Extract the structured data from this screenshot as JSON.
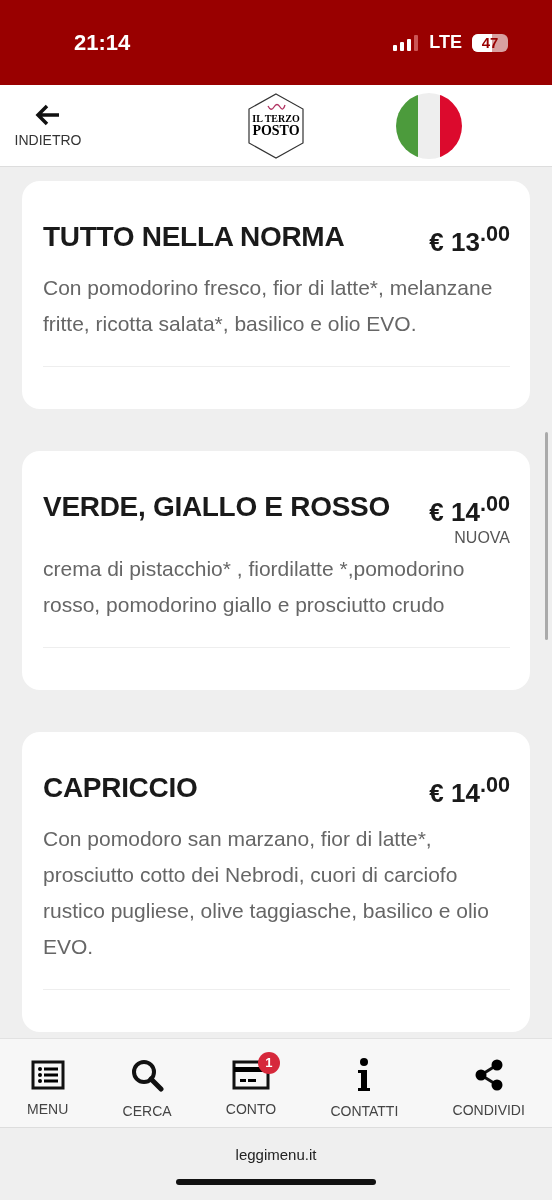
{
  "status_bar": {
    "time": "21:14",
    "network": "LTE",
    "battery": "47"
  },
  "header": {
    "back_label": "INDIETRO",
    "logo": {
      "line1": "IL TERZO",
      "line2": "POSTO"
    }
  },
  "dishes": [
    {
      "name": "TUTTO NELLA NORMA",
      "price": "€ 13$^{.00}$",
      "description": "Con pomodorino fresco, fior di latte*, melanzane fritte, ricotta salata*, basilico e olio EVO."
    },
    {
      "name": "VERDE, GIALLO E ROSSO",
      "price": "€ 14$^{.00}$",
      "badge": "NUOVA",
      "description": "crema di pistacchio* , fiordilatte *,pomodorino rosso, pomodorino giallo e prosciutto crudo"
    },
    {
      "name": "CAPRICCIO",
      "price": "€ 14$^{.00}$",
      "description": "Con pomodoro san marzano, fior di latte*, prosciutto cotto dei Nebrodi, cuori di carciofo rustico pugliese, olive taggiasche, basilico e olio EVO."
    }
  ],
  "tab_bar": [
    {
      "kind": "menu",
      "label": "MENU"
    },
    {
      "kind": "search",
      "label": "CERCA"
    },
    {
      "kind": "bill",
      "label": "CONTO",
      "badge": "1"
    },
    {
      "kind": "info",
      "label": "CONTATTI"
    },
    {
      "kind": "share",
      "label": "CONDIVIDI"
    }
  ],
  "footer": {
    "domain": "leggimenu.it"
  }
}
